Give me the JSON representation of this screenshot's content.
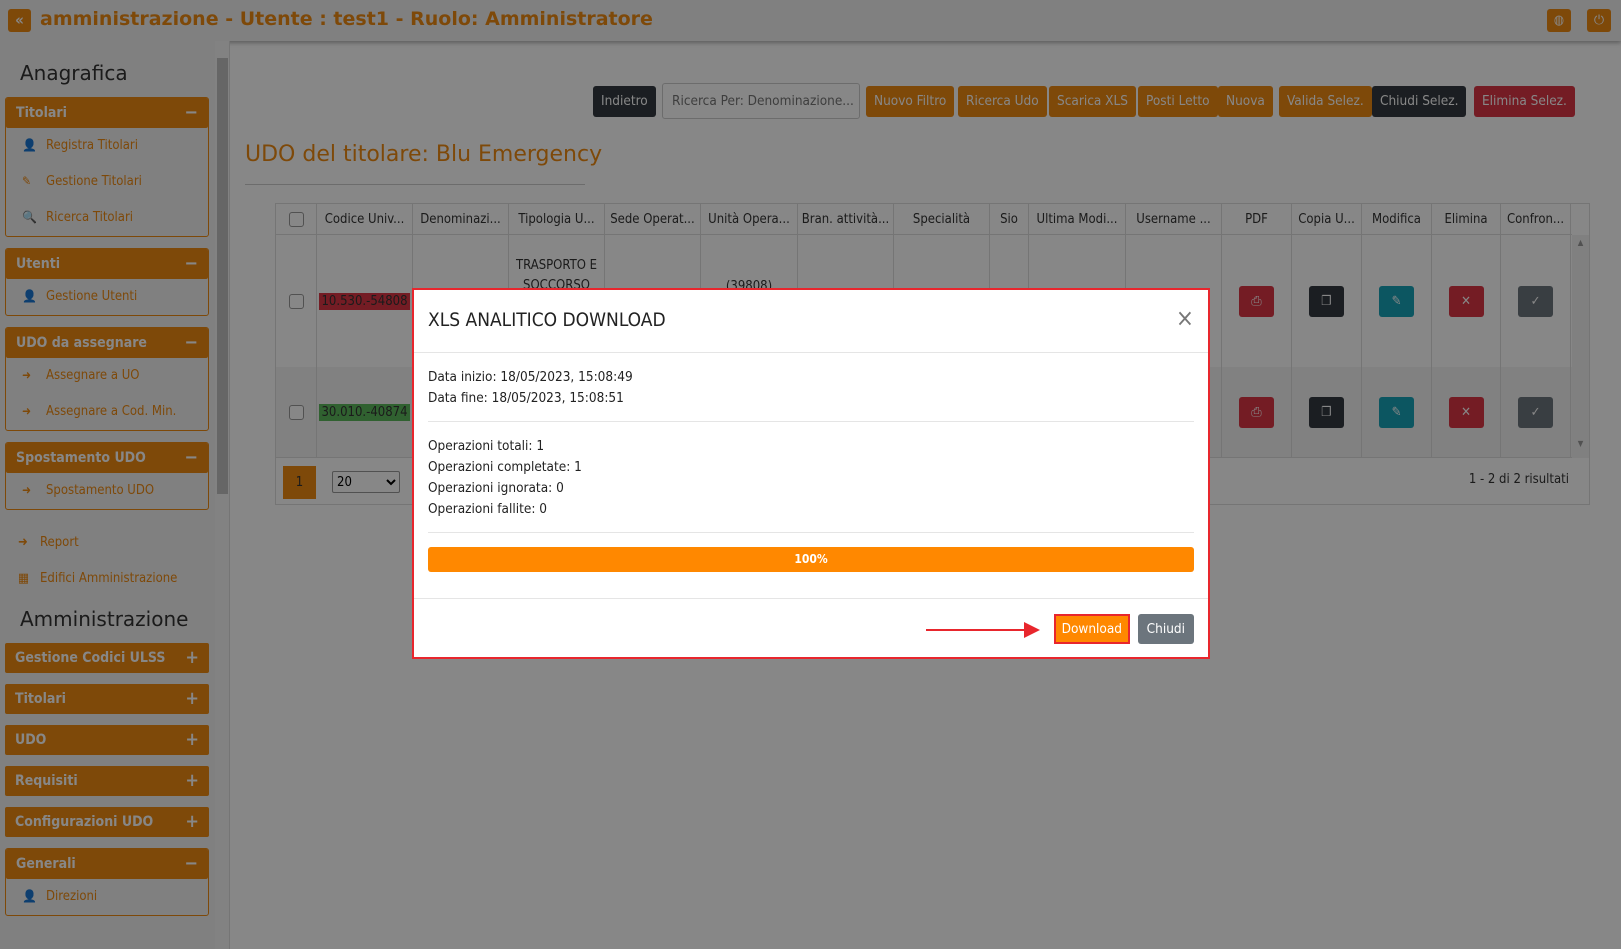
{
  "header": {
    "title": "amministrazione - Utente : test1 - Ruolo: Amministratore",
    "icons": [
      "double-chevron-left-icon",
      "globe-icon",
      "power-icon"
    ]
  },
  "sidebar": {
    "section1": "Anagrafica",
    "groups1": [
      {
        "title": "Titolari",
        "toggle": "−",
        "items": [
          {
            "label": "Registra Titolari",
            "icon": "user-edit-icon"
          },
          {
            "label": "Gestione Titolari",
            "icon": "edit-icon"
          },
          {
            "label": "Ricerca Titolari",
            "icon": "search-icon"
          }
        ]
      },
      {
        "title": "Utenti",
        "toggle": "−",
        "items": [
          {
            "label": "Gestione Utenti",
            "icon": "user-edit-icon"
          }
        ]
      },
      {
        "title": "UDO da assegnare",
        "toggle": "−",
        "items": [
          {
            "label": "Assegnare a UO",
            "icon": "arrow-right-icon"
          },
          {
            "label": "Assegnare a Cod. Min.",
            "icon": "arrow-right-icon"
          }
        ]
      },
      {
        "title": "Spostamento UDO",
        "toggle": "−",
        "items": [
          {
            "label": "Spostamento UDO",
            "icon": "arrow-right-icon"
          }
        ]
      }
    ],
    "links": [
      {
        "label": "Report",
        "icon": "arrow-right-icon"
      },
      {
        "label": "Edifici Amministrazione",
        "icon": "building-icon"
      }
    ],
    "section2": "Amministrazione",
    "groups2": [
      {
        "title": "Gestione Codici ULSS",
        "toggle": "+"
      },
      {
        "title": "Titolari",
        "toggle": "+"
      },
      {
        "title": "UDO",
        "toggle": "+"
      },
      {
        "title": "Requisiti",
        "toggle": "+"
      },
      {
        "title": "Configurazioni UDO",
        "toggle": "+"
      },
      {
        "title": "Generali",
        "toggle": "−",
        "items": [
          {
            "label": "Direzioni",
            "icon": "user-edit-icon"
          }
        ]
      }
    ]
  },
  "toolbar": {
    "back": "Indietro",
    "search_placeholder": "Ricerca Per: Denominazione...",
    "buttons": [
      "Nuovo Filtro",
      "Ricerca Udo",
      "Scarica XLS",
      "Posti Letto",
      "Nuova",
      "Valida Selez.",
      "Chiudi Selez.",
      "Elimina Selez."
    ]
  },
  "page_title": "UDO del titolare: Blu Emergency",
  "table": {
    "columns": [
      "",
      "Codice Univ...",
      "Denominazi...",
      "Tipologia U...",
      "Sede Operat...",
      "Unità Opera...",
      "Bran. attività...",
      "Specialità",
      "Sio",
      "Ultima Modi...",
      "Username ...",
      "PDF",
      "Copia U...",
      "Modifica",
      "Elimina",
      "Confron..."
    ],
    "rows": [
      {
        "codice": "10.530.-54808",
        "codice_color": "#dc3545",
        "tipologia": "TRASPORTO E SOCCORSO",
        "unita": "(39808)"
      },
      {
        "codice": "30.010.-40874",
        "codice_color": "#5cb85c",
        "tipologia": "",
        "unita": ""
      }
    ],
    "pager": {
      "page": "1",
      "page_size": "20",
      "info": "1 - 2 di 2 risultati"
    }
  },
  "modal": {
    "title": "XLS ANALITICO DOWNLOAD",
    "close": "×",
    "data_inizio": "Data inizio: 18/05/2023, 15:08:49",
    "data_fine": "Data fine: 18/05/2023, 15:08:51",
    "totali": "Operazioni totali: 1",
    "completate": "Operazioni completate: 1",
    "ignorata": "Operazioni ignorata: 0",
    "fallite": "Operazioni fallite: 0",
    "progress_percent": 100,
    "progress_label": "100%",
    "download": "Download",
    "chiudi": "Chiudi"
  },
  "colors": {
    "accent": "#ef8a12",
    "progress": "#ff8800",
    "danger": "#dc3545",
    "highlight": "#e8262d"
  }
}
